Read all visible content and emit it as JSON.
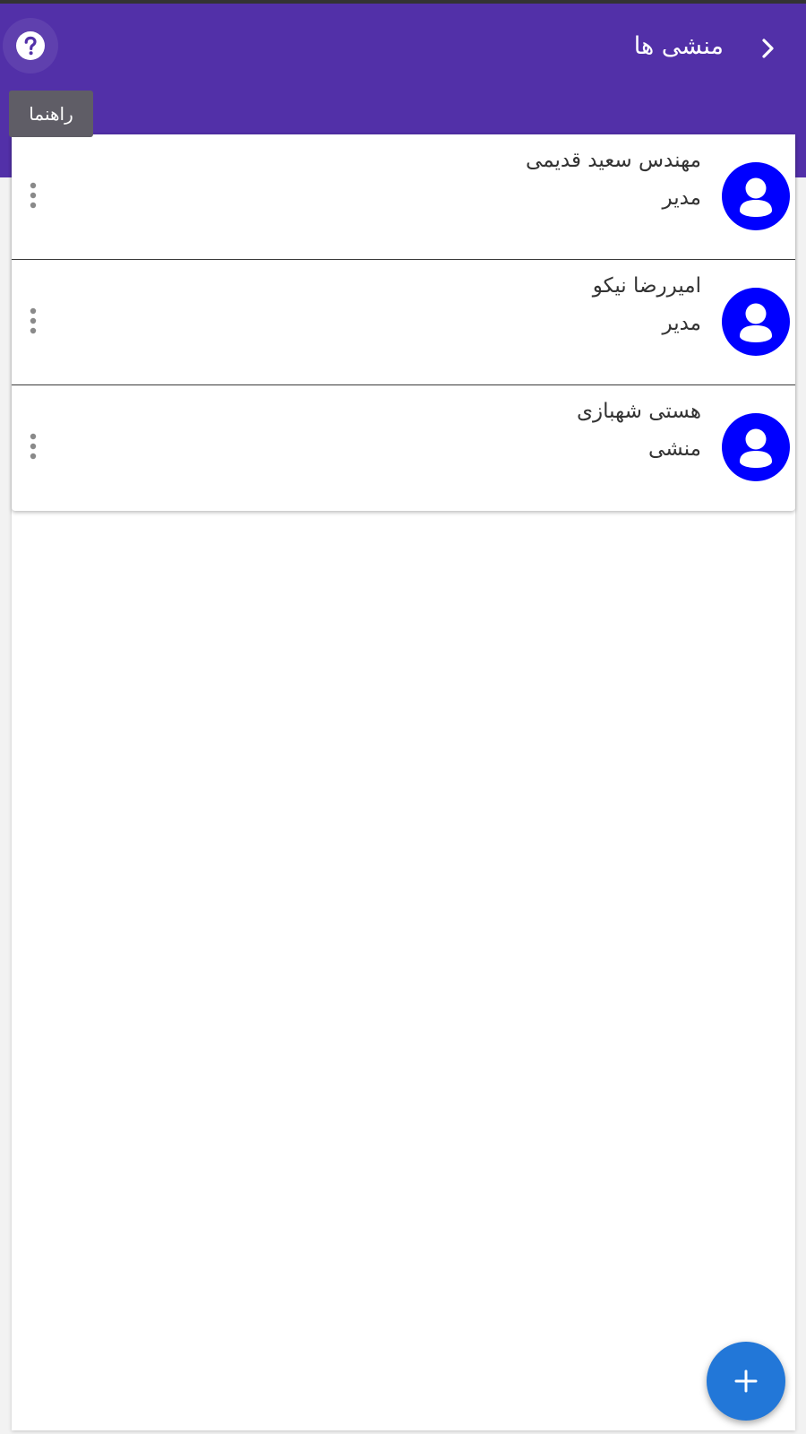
{
  "appbar": {
    "title": "منشی ها",
    "back_icon": "chevron-right-icon",
    "help_icon": "help-circle-icon",
    "help_tooltip": "راهنما"
  },
  "secretaries": [
    {
      "name": "مهندس سعید قدیمی",
      "role": "مدیر"
    },
    {
      "name": "امیررضا نیکو",
      "role": "مدیر"
    },
    {
      "name": "هستی شهبازی",
      "role": "منشی"
    }
  ],
  "fab": {
    "icon": "plus-icon"
  },
  "colors": {
    "primary": "#5230a8",
    "avatar": "#0000ff",
    "fab": "#2277d8",
    "tooltip": "#5f5d66"
  }
}
